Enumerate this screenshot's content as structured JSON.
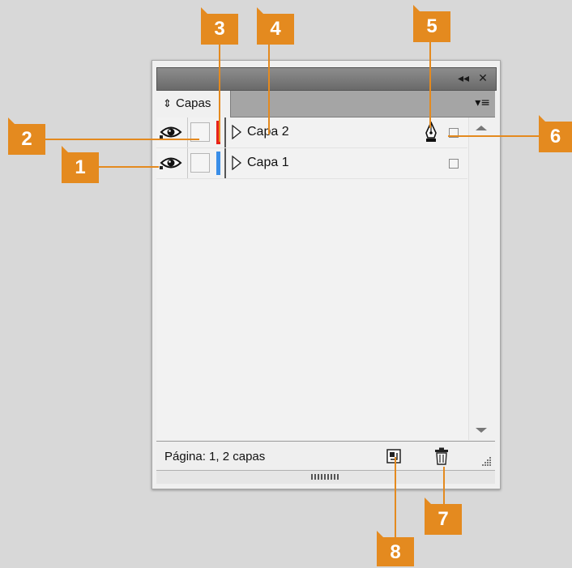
{
  "panel": {
    "title_buttons": {
      "collapse": "◂◂",
      "close": "✕"
    },
    "tab_label": "Capas",
    "tab_arrows": "⇕",
    "menu_icon": "▾≡",
    "layers": [
      {
        "name": "Capa 2",
        "color": "#e8221a",
        "visible": true,
        "has_pen": true
      },
      {
        "name": "Capa 1",
        "color": "#3a8ee8",
        "visible": true,
        "has_pen": false
      }
    ],
    "status": "Página: 1, 2 capas"
  },
  "callouts": {
    "c1": "1",
    "c2": "2",
    "c3": "3",
    "c4": "4",
    "c5": "5",
    "c6": "6",
    "c7": "7",
    "c8": "8"
  },
  "colors": {
    "callout": "#e48a1f"
  }
}
